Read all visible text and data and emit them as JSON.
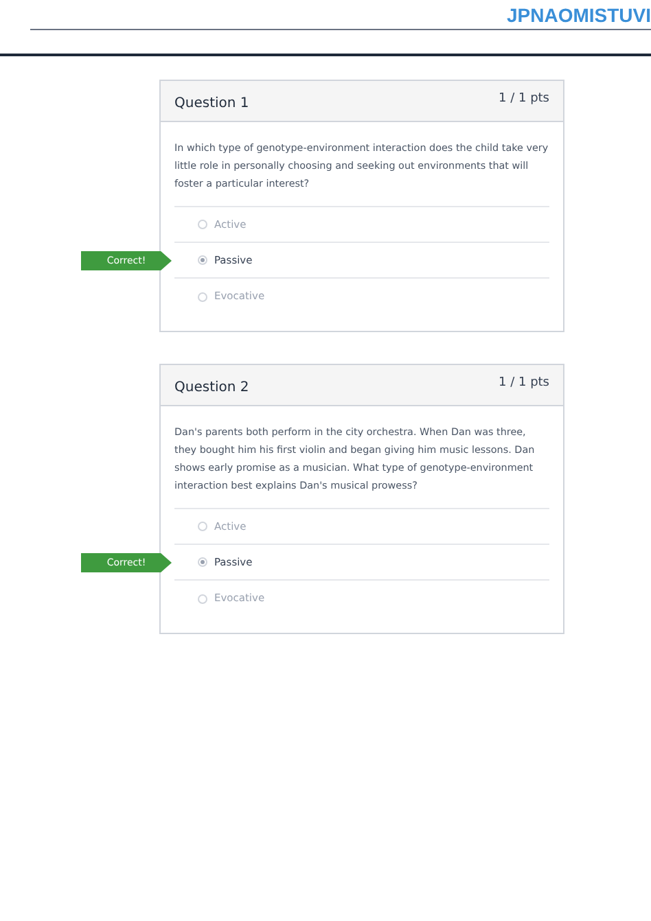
{
  "header": {
    "title": "JPNAOMISTUVI"
  },
  "questions": [
    {
      "title": "Question 1",
      "points": "1 / 1 pts",
      "text": "In which type of genotype-environment interaction does the child take very little role in personally choosing and seeking out environments that will foster a particular interest?",
      "answers": [
        {
          "label": "Active",
          "selected": false
        },
        {
          "label": "Passive",
          "selected": true,
          "badge": "Correct!"
        },
        {
          "label": "Evocative",
          "selected": false
        }
      ]
    },
    {
      "title": "Question 2",
      "points": "1 / 1 pts",
      "text": "Dan's parents both perform in the city orchestra. When Dan was three, they bought him his first violin and began giving him music lessons. Dan shows early promise as a musician. What type of genotype-environment interaction best explains Dan's musical prowess?",
      "answers": [
        {
          "label": "Active",
          "selected": false
        },
        {
          "label": "Passive",
          "selected": true,
          "badge": "Correct!"
        },
        {
          "label": "Evocative",
          "selected": false
        }
      ]
    }
  ]
}
